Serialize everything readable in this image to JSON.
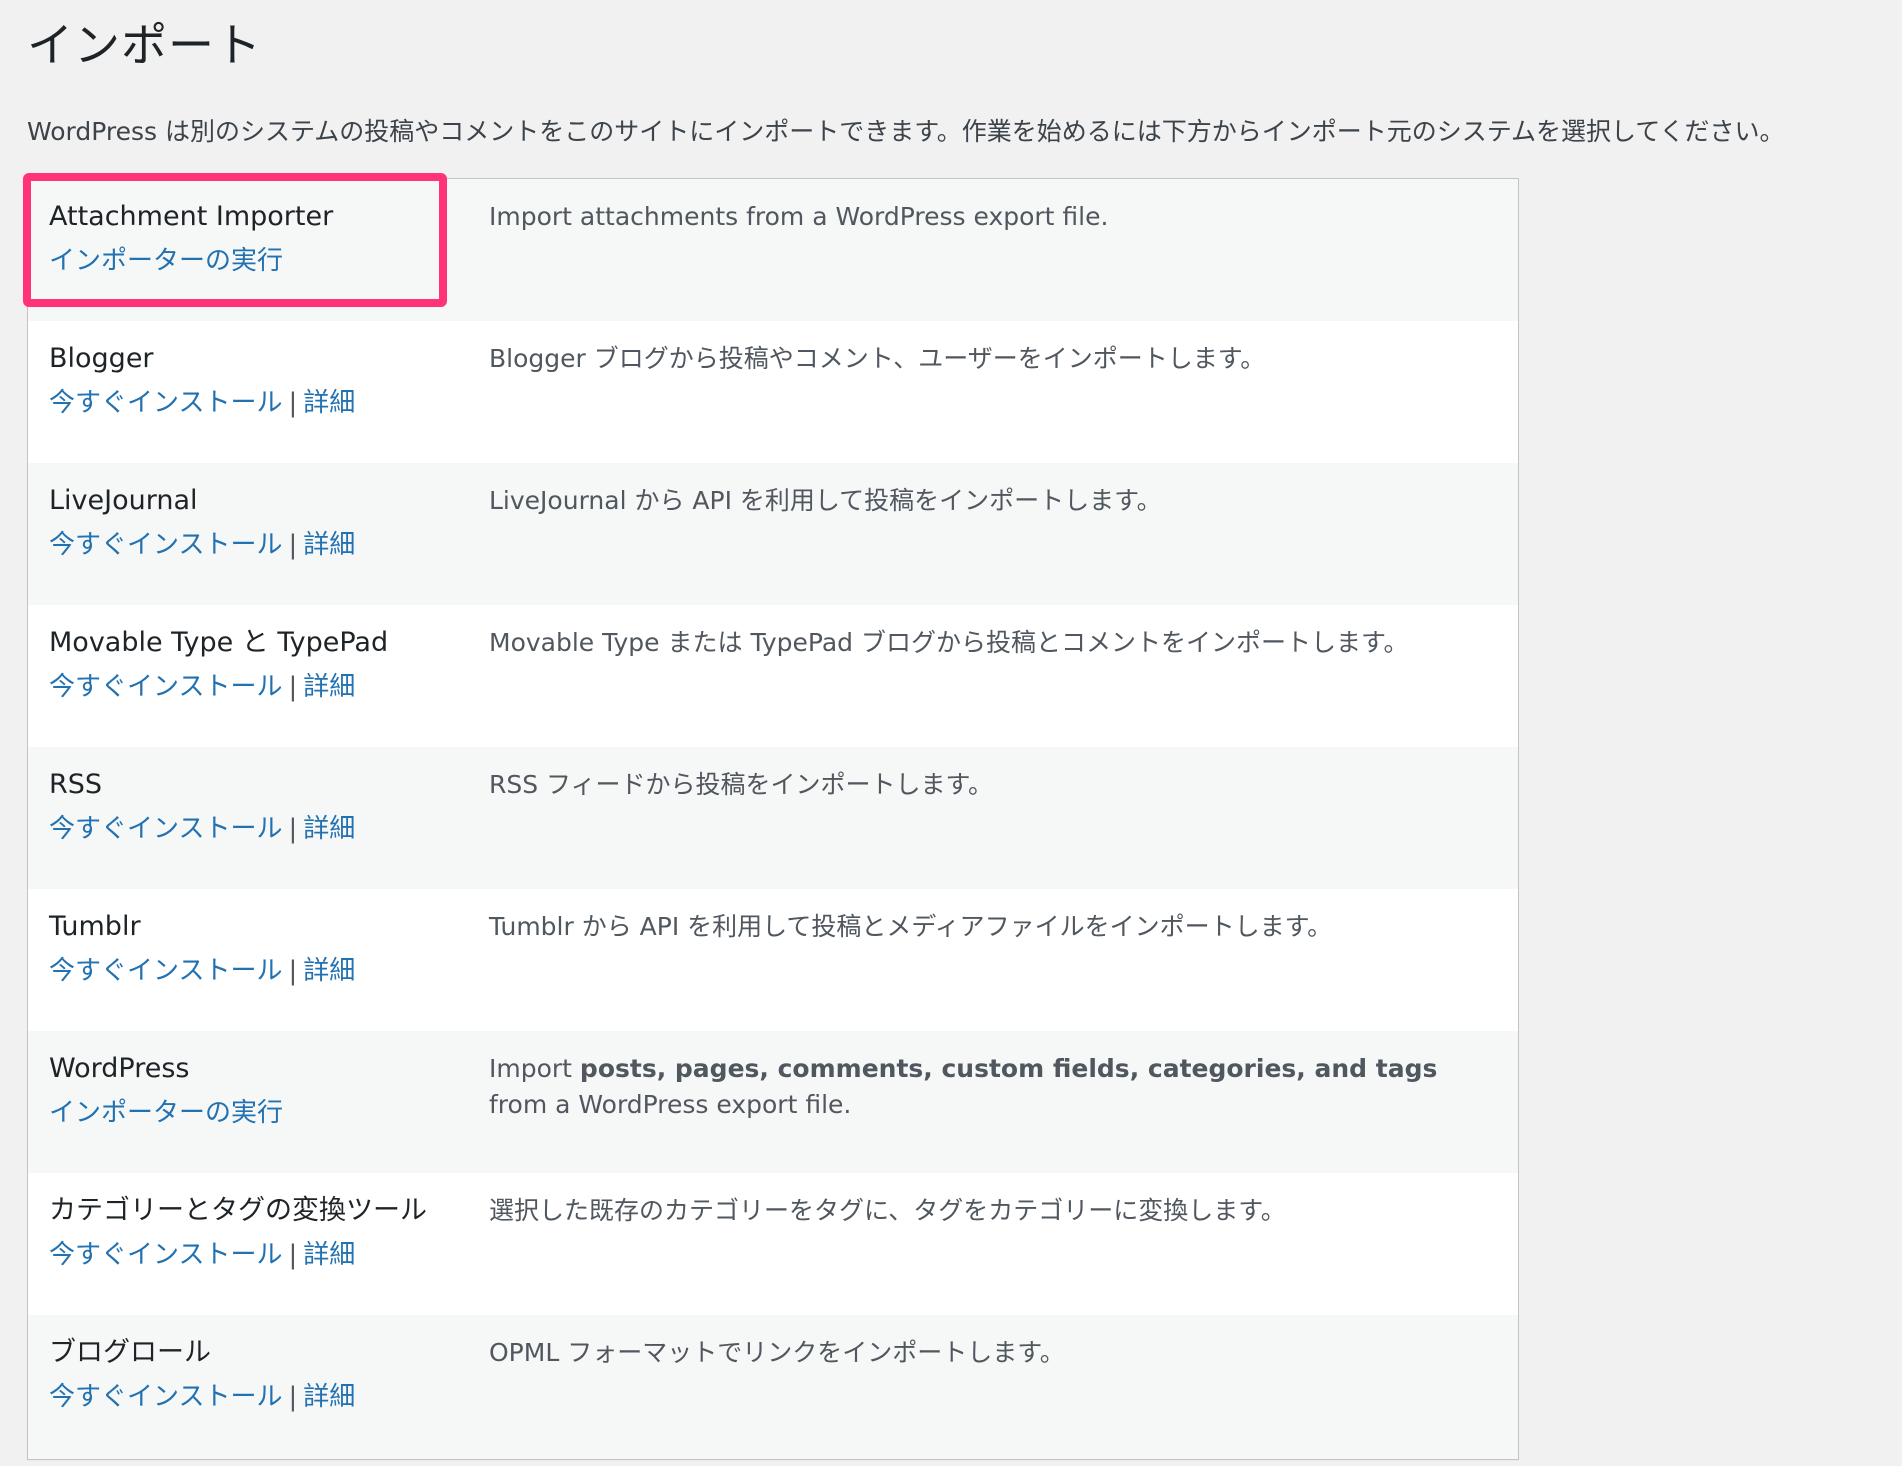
{
  "page": {
    "title": "インポート",
    "intro": "WordPress は別のシステムの投稿やコメントをこのサイトにインポートできます。作業を始めるには下方からインポート元のシステムを選択してください。",
    "highlight_color": "#ff3375",
    "link_color": "#2271b1"
  },
  "importers": [
    {
      "name": "Attachment Importer",
      "action": "インポーターの実行",
      "description": "Import attachments from a WordPress export file."
    },
    {
      "name": "Blogger",
      "install": "今すぐインストール",
      "separator": "|",
      "details": "詳細",
      "description": "Blogger ブログから投稿やコメント、ユーザーをインポートします。"
    },
    {
      "name": "LiveJournal",
      "install": "今すぐインストール",
      "separator": "|",
      "details": "詳細",
      "description": "LiveJournal から API を利用して投稿をインポートします。"
    },
    {
      "name": "Movable Type と TypePad",
      "install": "今すぐインストール",
      "separator": "|",
      "details": "詳細",
      "description": "Movable Type または TypePad ブログから投稿とコメントをインポートします。"
    },
    {
      "name": "RSS",
      "install": "今すぐインストール",
      "separator": "|",
      "details": "詳細",
      "description": "RSS フィードから投稿をインポートします。"
    },
    {
      "name": "Tumblr",
      "install": "今すぐインストール",
      "separator": "|",
      "details": "詳細",
      "description": "Tumblr から API を利用して投稿とメディアファイルをインポートします。"
    },
    {
      "name": "WordPress",
      "action": "インポーターの実行",
      "desc_prefix": "Import ",
      "desc_bold": "posts, pages, comments, custom fields, categories, and tags",
      "desc_suffix": " from a WordPress export file."
    },
    {
      "name": "カテゴリーとタグの変換ツール",
      "install": "今すぐインストール",
      "separator": "|",
      "details": "詳細",
      "description": "選択した既存のカテゴリーをタグに、タグをカテゴリーに変換します。"
    },
    {
      "name": "ブログロール",
      "install": "今すぐインストール",
      "separator": "|",
      "details": "詳細",
      "description": "OPML フォーマットでリンクをインポートします。"
    }
  ]
}
